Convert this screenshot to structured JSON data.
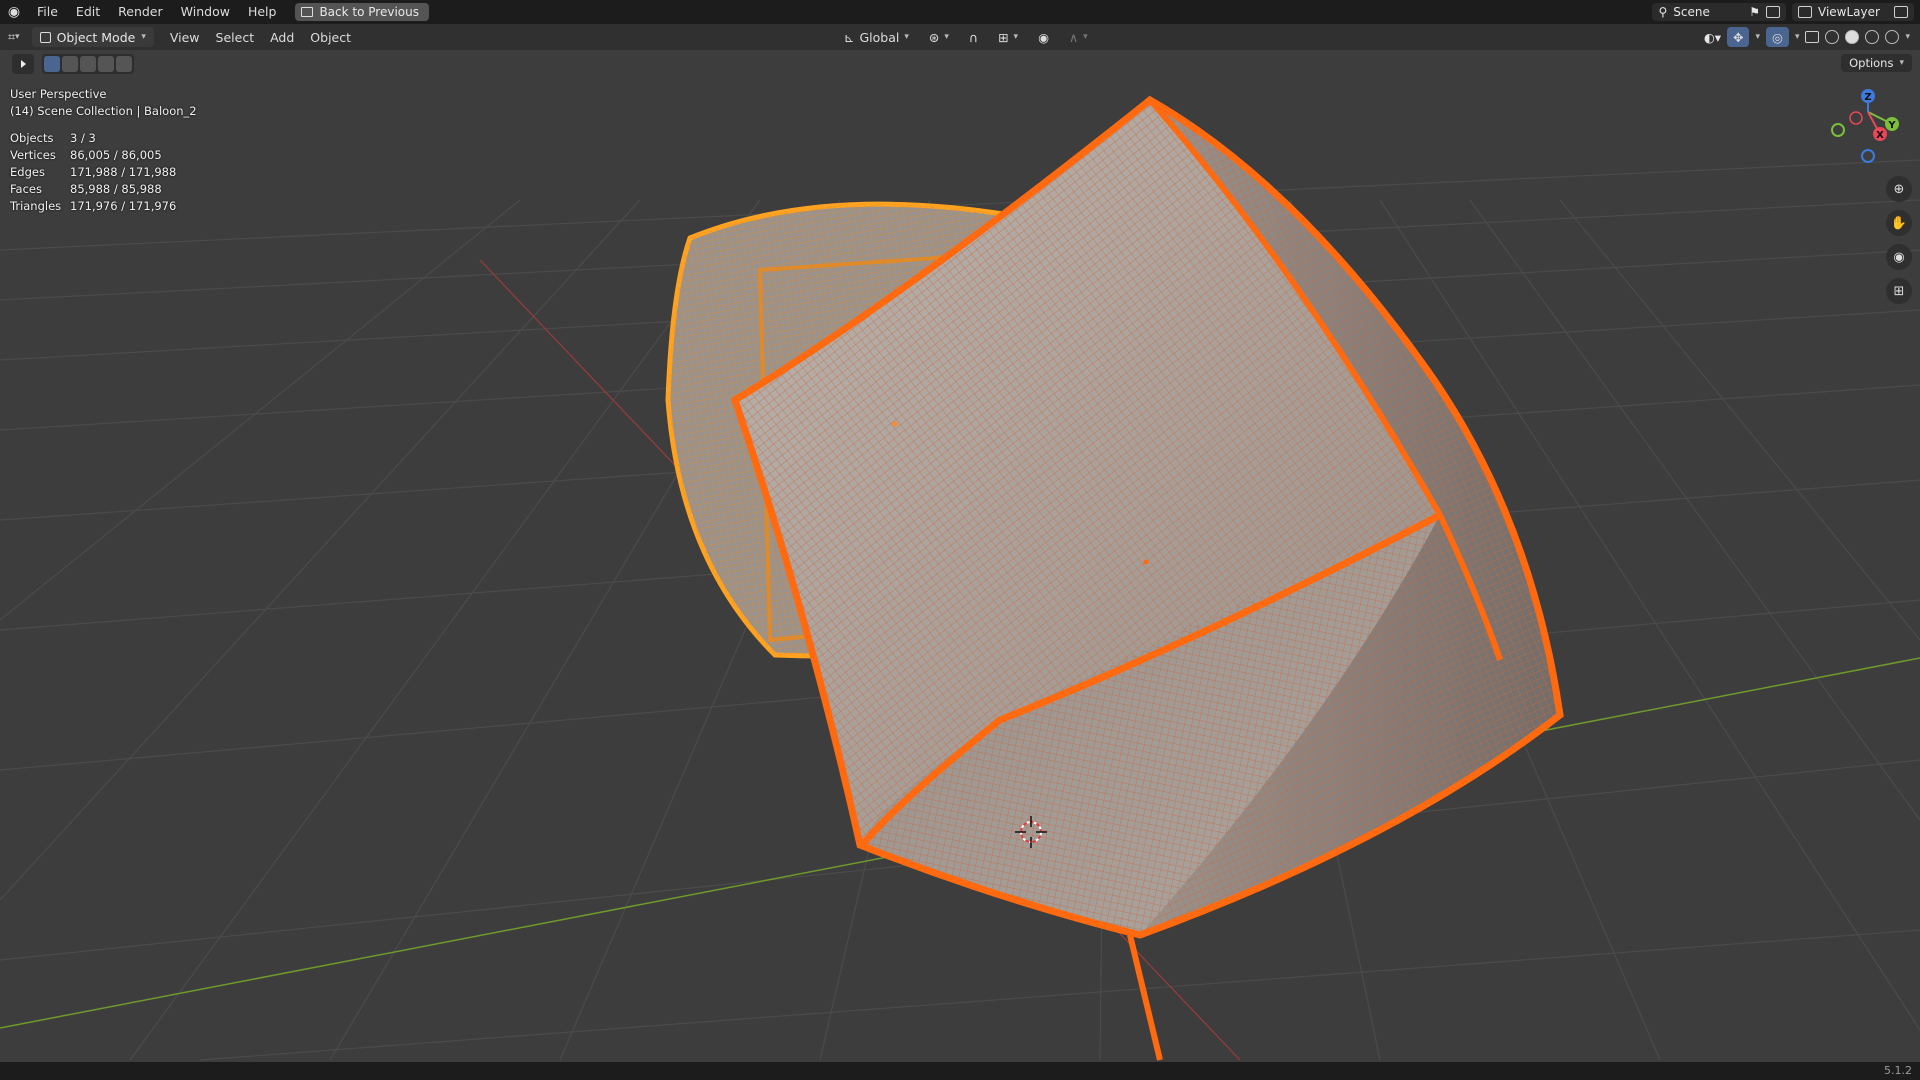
{
  "menubar": {
    "items": [
      "File",
      "Edit",
      "Render",
      "Window",
      "Help"
    ],
    "back_label": "Back to Previous",
    "scene": "Scene",
    "view_layer": "ViewLayer"
  },
  "header": {
    "mode": "Object Mode",
    "view": "View",
    "select": "Select",
    "add": "Add",
    "object": "Object",
    "orientation": "Global",
    "options": "Options"
  },
  "overlay": {
    "perspective": "User Perspective",
    "collection": "(14) Scene Collection | Baloon_2",
    "stats": [
      {
        "label": "Objects",
        "value": "3 / 3"
      },
      {
        "label": "Vertices",
        "value": "86,005 / 86,005"
      },
      {
        "label": "Edges",
        "value": "171,988 / 171,988"
      },
      {
        "label": "Faces",
        "value": "85,988 / 85,988"
      },
      {
        "label": "Triangles",
        "value": "171,976 / 171,976"
      }
    ]
  },
  "gizmo": {
    "axis_z": "Z",
    "axis_y": "Y",
    "axis_x": "X",
    "colors": {
      "x": "#e8475a",
      "y": "#7bbf3a",
      "z": "#3d7be0"
    }
  },
  "icons": {
    "zoom": "zoom-icon",
    "pan": "hand-icon",
    "camera": "camera-icon",
    "grid": "perspective-grid-icon"
  },
  "colors": {
    "selected_outline": "#ff6a10",
    "active_outline": "#ffa21f",
    "viewport_bg": "#3d3d3d"
  },
  "status": {
    "version": "5.1.2"
  }
}
